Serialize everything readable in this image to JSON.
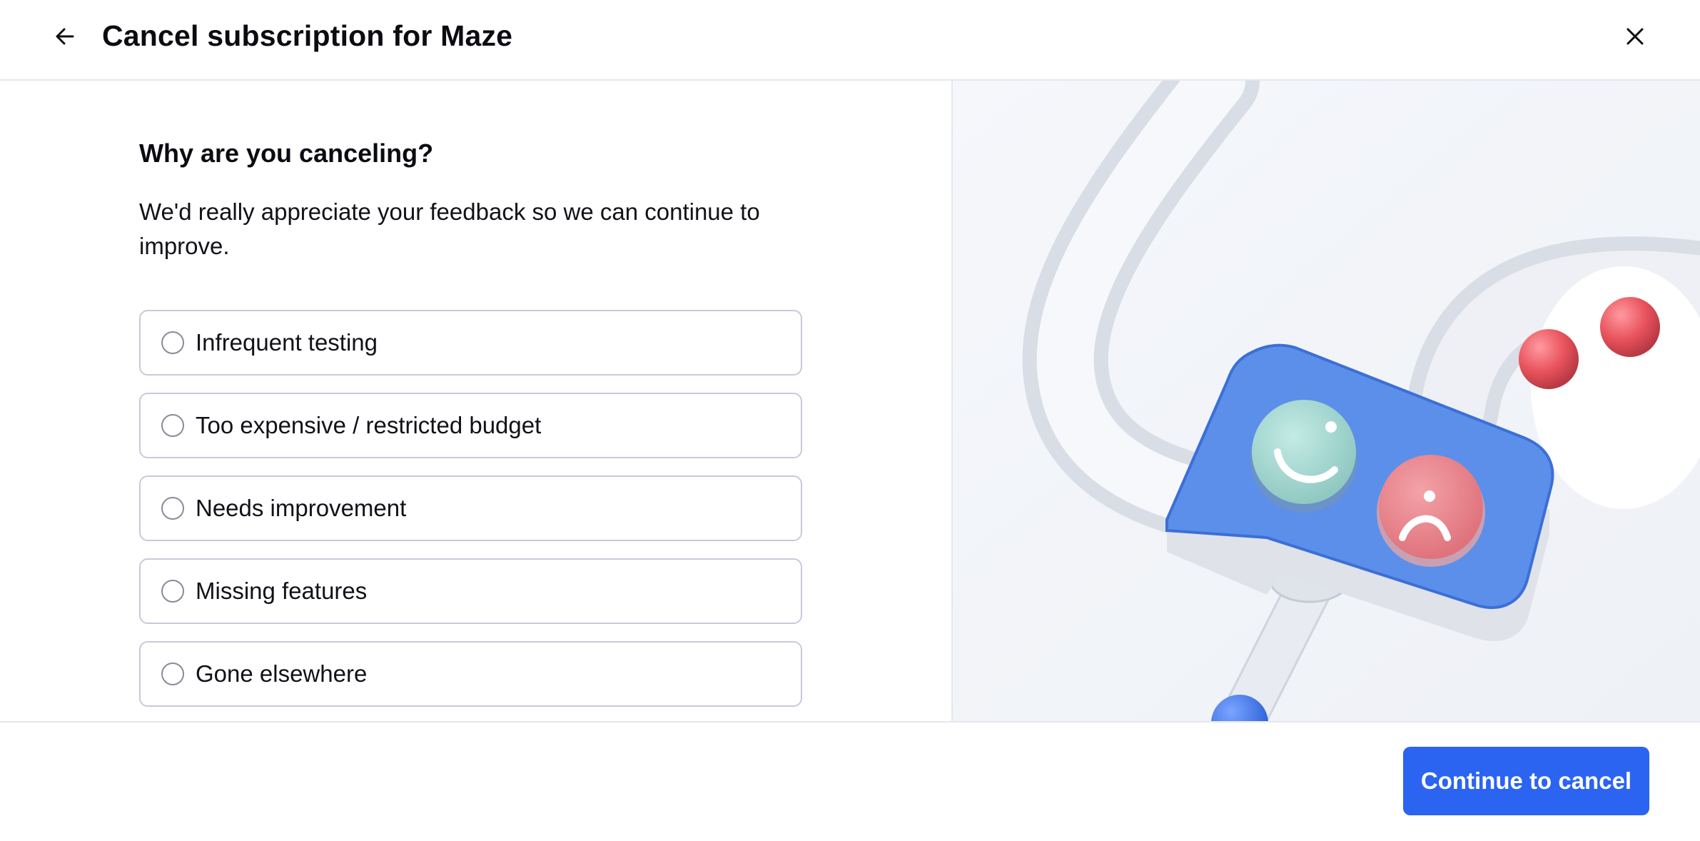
{
  "header": {
    "title": "Cancel subscription for Maze",
    "back_icon": "arrow-left-icon",
    "close_icon": "close-icon"
  },
  "form": {
    "question": "Why are you canceling?",
    "subtext": "We'd really appreciate your feedback so we can continue to improve.",
    "options": [
      {
        "label": "Infrequent testing",
        "selected": false
      },
      {
        "label": "Too expensive / restricted budget",
        "selected": false
      },
      {
        "label": "Needs improvement",
        "selected": false
      },
      {
        "label": "Missing features",
        "selected": false
      },
      {
        "label": "Gone elsewhere",
        "selected": false
      }
    ]
  },
  "illustration": {
    "icons": [
      "smiley-face-icon",
      "sad-face-icon"
    ]
  },
  "footer": {
    "continue_label": "Continue to cancel"
  },
  "colors": {
    "primary": "#2a64f0",
    "border": "#c9c9d9",
    "divider": "#e6e6ee",
    "speech_bubble": "#5b8fea",
    "happy": "#9fd3cd",
    "sad": "#e98088",
    "ball": "#e8525c"
  }
}
